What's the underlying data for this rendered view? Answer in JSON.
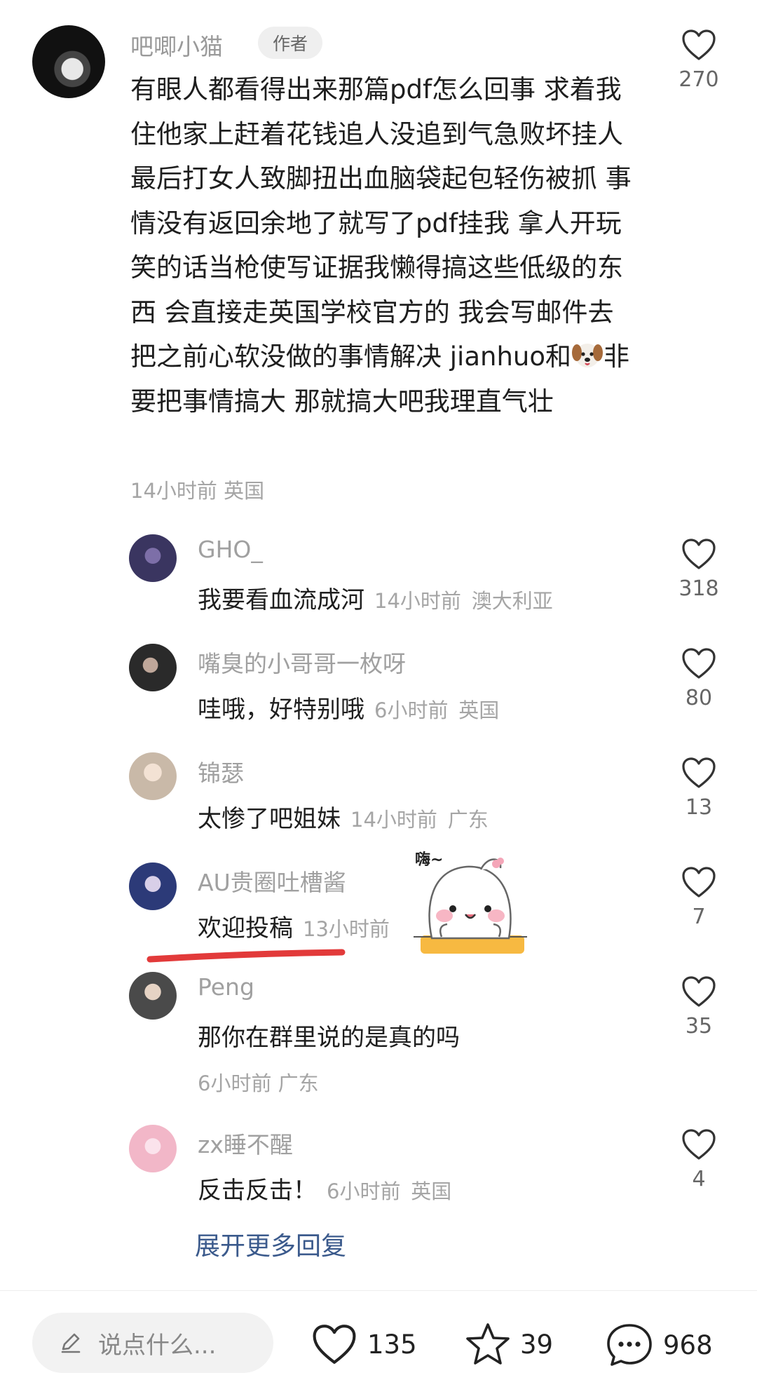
{
  "author_comment": {
    "username": "吧唧小猫",
    "badge": "作者",
    "text_before_emoji": "有眼人都看得出来那篇pdf怎么回事 求着我住他家上赶着花钱追人没追到气急败坏挂人 最后打女人致脚扭出血脑袋起包轻伤被抓 事情没有返回余地了就写了pdf挂我 拿人开玩笑的话当枪使写证据我懒得搞这些低级的东西 会直接走英国学校官方的 我会写邮件去把之前心软没做的事情解决 jianhuo和",
    "emoji": "dog-face",
    "text_after_emoji": "非要把事情搞大 那就搞大吧我理直气壮",
    "time": "14小时前",
    "location": "英国",
    "likes": "270"
  },
  "replies": [
    {
      "username": "GHO_",
      "text": "我要看血流成河",
      "time": "14小时前",
      "location": "澳大利亚",
      "likes": "318",
      "avatar_color": "#3a3560"
    },
    {
      "username": "嘴臭的小哥哥一枚呀",
      "text": "哇哦，好特别哦",
      "time": "6小时前",
      "location": "英国",
      "likes": "80",
      "avatar_color": "#2a2a2a"
    },
    {
      "username": "锦瑟",
      "text": "太惨了吧姐妹",
      "time": "14小时前",
      "location": "广东",
      "likes": "13",
      "avatar_color": "#c9b9a8"
    },
    {
      "username": "AU贵圈吐槽酱",
      "text": "欢迎投稿",
      "time": "13小时前",
      "location": "",
      "likes": "7",
      "avatar_color": "#2c3a78"
    },
    {
      "username": "Peng",
      "text": "那你在群里说的是真的吗",
      "time": "6小时前",
      "location": "广东",
      "likes": "35",
      "avatar_color": "#4a4a4a"
    },
    {
      "username": "zx睡不醒",
      "text": "反击反击！",
      "time": "6小时前",
      "location": "英国",
      "likes": "4",
      "avatar_color": "#f2b7c8"
    }
  ],
  "sticker_text": "嗨~",
  "expand_more": "展开更多回复",
  "bottom_bar": {
    "input_placeholder": "说点什么...",
    "likes": "135",
    "favorites": "39",
    "comments": "968"
  }
}
